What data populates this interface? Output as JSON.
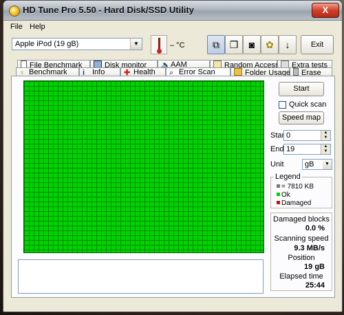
{
  "window": {
    "title": "HD Tune Pro 5.50 - Hard Disk/SSD Utility",
    "close": "X"
  },
  "menu": {
    "file": "File",
    "help": "Help"
  },
  "toolbar": {
    "drive": "Apple   iPod (19 gB)",
    "temperature": "– °C",
    "exit_label": "Exit"
  },
  "tabs_top": [
    "File Benchmark",
    "Disk monitor",
    "AAM",
    "Random Access",
    "Extra tests"
  ],
  "tabs_bottom": [
    "Benchmark",
    "Info",
    "Health",
    "Error Scan",
    "Folder Usage",
    "Erase"
  ],
  "active_tab": "Error Scan",
  "scan": {
    "start_button": "Start",
    "quick_scan_label": "Quick scan",
    "quick_scan_checked": false,
    "speed_map_button": "Speed map",
    "start_label": "Start",
    "start_value": "0",
    "end_label": "End",
    "end_value": "19",
    "unit_label": "Unit",
    "unit_value": "gB"
  },
  "legend": {
    "title": "Legend",
    "block_size": "= 7810 KB",
    "ok": "Ok",
    "damaged": "Damaged",
    "ok_color": "#00d400",
    "damaged_color": "#c81010",
    "block_color": "#7a7a7a"
  },
  "stats": {
    "damaged_blocks_label": "Damaged blocks",
    "damaged_blocks_value": "0.0 %",
    "scanning_speed_label": "Scanning speed",
    "scanning_speed_value": "9.3 MB/s",
    "position_label": "Position",
    "position_value": "19 gB",
    "elapsed_label": "Elapsed time",
    "elapsed_value": "25:44"
  },
  "scan_result": {
    "ok_fraction": 1.0
  }
}
